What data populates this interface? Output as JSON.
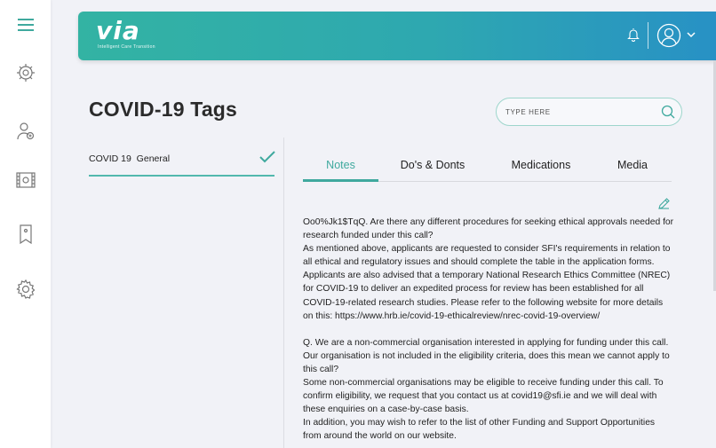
{
  "header": {
    "logo_text": "via",
    "logo_tagline": "Intelligent Care Transition"
  },
  "sidebar": {
    "items": [
      {
        "name": "menu"
      },
      {
        "name": "dashboard"
      },
      {
        "name": "patients"
      },
      {
        "name": "media"
      },
      {
        "name": "tags"
      },
      {
        "name": "settings"
      }
    ]
  },
  "page": {
    "title": "COVID-19 Tags"
  },
  "search": {
    "placeholder": "TYPE HERE"
  },
  "tags_list": [
    {
      "label": "COVID 19  General",
      "selected": true
    }
  ],
  "tabs": [
    {
      "label": "Notes",
      "active": true
    },
    {
      "label": "Do's & Donts",
      "active": false
    },
    {
      "label": "Medications",
      "active": false
    },
    {
      "label": "Media",
      "active": false
    }
  ],
  "notes": {
    "paragraphs": [
      "Oo0%Jk1$TqQ. Are there any different procedures for seeking ethical approvals needed for research funded under this call?",
      "As mentioned above, applicants are requested to consider SFI's requirements in relation to all ethical and regulatory issues and should complete the table in the application forms.",
      "Applicants are also advised that a temporary National Research Ethics Committee (NREC) for COVID-19 to deliver an expedited process for review has been established for all COVID-19-related research studies. Please refer to the following website for more details on this: https://www.hrb.ie/covid-19-ethicalreview/nrec-covid-19-overview/",
      "",
      "Q. We are a non-commercial organisation interested in applying for funding under this call. Our organisation is not included in the eligibility criteria, does this mean we cannot apply to this call?",
      "Some non-commercial organisations may be eligible to receive funding under this call. To confirm eligibility, we request that you contact us at covid19@sfi.ie and we will deal with these enquiries on a case-by-case basis.",
      "In addition, you may wish to refer to the list of other Funding and Support Opportunities from around the world on our website."
    ]
  },
  "colors": {
    "accent": "#3fa99e",
    "header_start": "#33b3a3",
    "header_end": "#2891c5"
  }
}
